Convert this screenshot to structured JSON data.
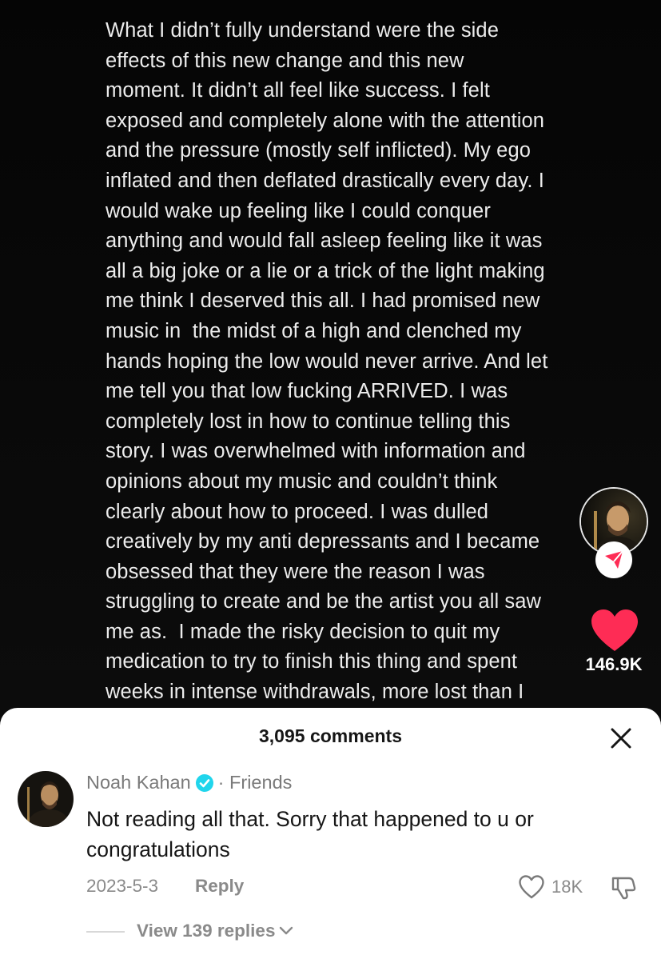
{
  "post": {
    "lines": [
      "What I didn’t fully understand were the side",
      "effects of this new change and this new",
      "moment. It didn’t all feel like success. I felt",
      "exposed and completely alone with the attention",
      "and the pressure (mostly self inflicted). My ego",
      "inflated and then deflated drastically every day. I",
      "would wake up feeling like I could conquer",
      "anything and would fall asleep feeling like it was",
      "all a big joke or a lie or a trick of the light making",
      "me think I deserved this all. I had promised new",
      "music in  the midst of a high and clenched my",
      "hands hoping the low would never arrive. And let",
      "me tell you that low fucking ARRIVED. I was",
      "completely lost in how to continue telling this",
      "story. I was overwhelmed with information and",
      "opinions about my music and couldn’t think",
      "clearly about how to proceed. I was dulled",
      "creatively by my anti depressants and I became",
      "obsessed that they were the reason I was",
      "struggling to create and be the artist you all saw",
      "me as.  I made the risky decision to quit my",
      "medication to try to finish this thing and spent",
      "weeks in intense withdrawals, more lost than I"
    ]
  },
  "rail": {
    "avatar_icon": "profile-avatar",
    "follow_icon": "send-arrow-icon",
    "like_icon": "heart-icon",
    "like_count": "146.9K",
    "like_color": "#fe2c55"
  },
  "comments": {
    "title": "3,095 comments",
    "close_icon": "close-icon",
    "items": [
      {
        "author": "Noah Kahan",
        "verified_color": "#20d5ec",
        "relation": "· Friends",
        "text": "Not reading all that. Sorry that happened to u or congratulations",
        "date": "2023-5-3",
        "reply_label": "Reply",
        "likes": "18K",
        "view_replies": "View 139 replies"
      }
    ]
  }
}
